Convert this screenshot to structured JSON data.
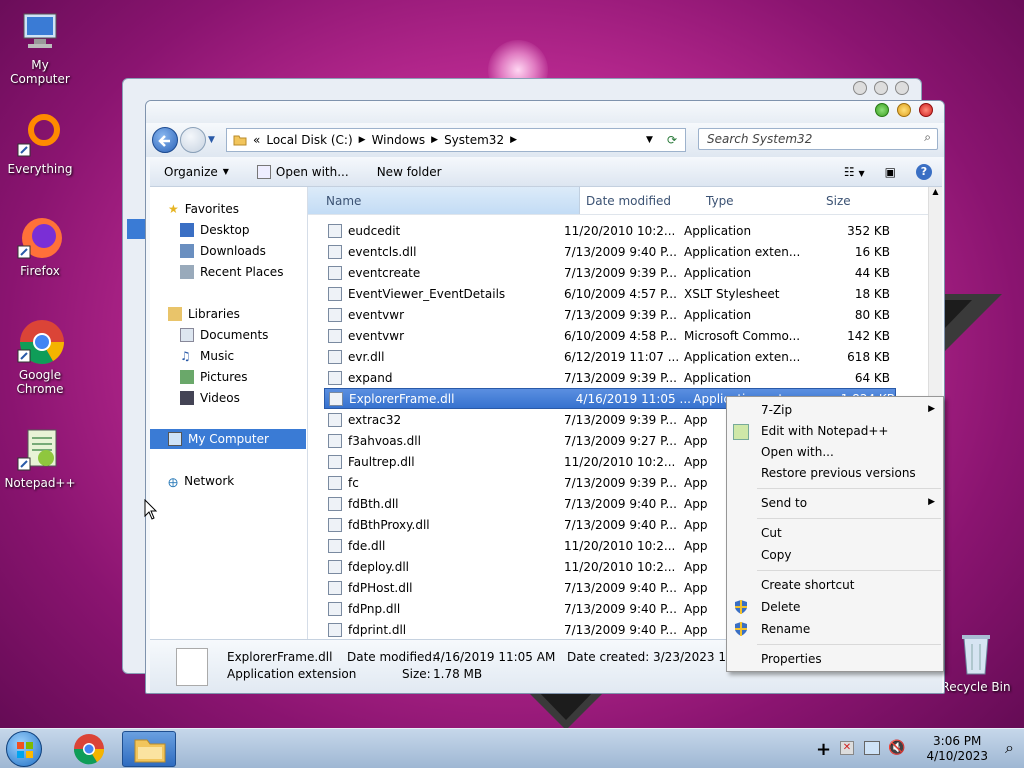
{
  "desktop": {
    "icons": [
      {
        "label": "My Computer",
        "icon": "my-computer-icon"
      },
      {
        "label": "Everything",
        "icon": "everything-icon"
      },
      {
        "label": "Firefox",
        "icon": "firefox-icon"
      },
      {
        "label": "Google Chrome",
        "icon": "chrome-icon"
      },
      {
        "label": "Notepad++",
        "icon": "notepad-plus-plus-icon"
      },
      {
        "label": "Recycle Bin",
        "icon": "recycle-bin-icon"
      }
    ]
  },
  "address": {
    "root": "«",
    "crumbs": [
      "Local Disk (C:)",
      "Windows",
      "System32"
    ],
    "search_placeholder": "Search System32"
  },
  "toolbar": {
    "organize": "Organize",
    "open_with": "Open with...",
    "new_folder": "New folder"
  },
  "nav": {
    "favorites": "Favorites",
    "desktop": "Desktop",
    "downloads": "Downloads",
    "recent": "Recent Places",
    "libraries": "Libraries",
    "documents": "Documents",
    "music": "Music",
    "pictures": "Pictures",
    "videos": "Videos",
    "my_computer": "My Computer",
    "network": "Network"
  },
  "columns": {
    "name": "Name",
    "date": "Date modified",
    "type": "Type",
    "size": "Size"
  },
  "files": [
    {
      "name": "eudcedit",
      "date": "11/20/2010 10:2...",
      "type": "Application",
      "size": "352 KB"
    },
    {
      "name": "eventcls.dll",
      "date": "7/13/2009 9:40 P...",
      "type": "Application exten...",
      "size": "16 KB"
    },
    {
      "name": "eventcreate",
      "date": "7/13/2009 9:39 P...",
      "type": "Application",
      "size": "44 KB"
    },
    {
      "name": "EventViewer_EventDetails",
      "date": "6/10/2009 4:57 P...",
      "type": "XSLT Stylesheet",
      "size": "18 KB"
    },
    {
      "name": "eventvwr",
      "date": "7/13/2009 9:39 P...",
      "type": "Application",
      "size": "80 KB"
    },
    {
      "name": "eventvwr",
      "date": "6/10/2009 4:58 P...",
      "type": "Microsoft Commo...",
      "size": "142 KB"
    },
    {
      "name": "evr.dll",
      "date": "6/12/2019 11:07 ...",
      "type": "Application exten...",
      "size": "618 KB"
    },
    {
      "name": "expand",
      "date": "7/13/2009 9:39 P...",
      "type": "Application",
      "size": "64 KB"
    },
    {
      "name": "ExplorerFrame.dll",
      "date": "4/16/2019 11:05 ...",
      "type": "Application ext...",
      "size": "1,824 KB"
    },
    {
      "name": "extrac32",
      "date": "7/13/2009 9:39 P...",
      "type": "App",
      "size": ""
    },
    {
      "name": "f3ahvoas.dll",
      "date": "7/13/2009 9:27 P...",
      "type": "App",
      "size": ""
    },
    {
      "name": "Faultrep.dll",
      "date": "11/20/2010 10:2...",
      "type": "App",
      "size": ""
    },
    {
      "name": "fc",
      "date": "7/13/2009 9:39 P...",
      "type": "App",
      "size": ""
    },
    {
      "name": "fdBth.dll",
      "date": "7/13/2009 9:40 P...",
      "type": "App",
      "size": ""
    },
    {
      "name": "fdBthProxy.dll",
      "date": "7/13/2009 9:40 P...",
      "type": "App",
      "size": ""
    },
    {
      "name": "fde.dll",
      "date": "11/20/2010 10:2...",
      "type": "App",
      "size": ""
    },
    {
      "name": "fdeploy.dll",
      "date": "11/20/2010 10:2...",
      "type": "App",
      "size": ""
    },
    {
      "name": "fdPHost.dll",
      "date": "7/13/2009 9:40 P...",
      "type": "App",
      "size": ""
    },
    {
      "name": "fdPnp.dll",
      "date": "7/13/2009 9:40 P...",
      "type": "App",
      "size": ""
    },
    {
      "name": "fdprint.dll",
      "date": "7/13/2009 9:40 P...",
      "type": "App",
      "size": ""
    }
  ],
  "details": {
    "filename": "ExplorerFrame.dll",
    "filetype": "Application extension",
    "modified_label": "Date modified:",
    "modified": "4/16/2019 11:05 AM",
    "size_label": "Size:",
    "size": "1.78 MB",
    "created_label": "Date created:",
    "created": "3/23/2023 1:18 A"
  },
  "context_menu": {
    "zip": "7-Zip",
    "notepad": "Edit with Notepad++",
    "open_with": "Open with...",
    "restore": "Restore previous versions",
    "send_to": "Send to",
    "cut": "Cut",
    "copy": "Copy",
    "shortcut": "Create shortcut",
    "delete": "Delete",
    "rename": "Rename",
    "properties": "Properties"
  },
  "taskbar": {
    "time": "3:06 PM",
    "date": "4/10/2023"
  }
}
